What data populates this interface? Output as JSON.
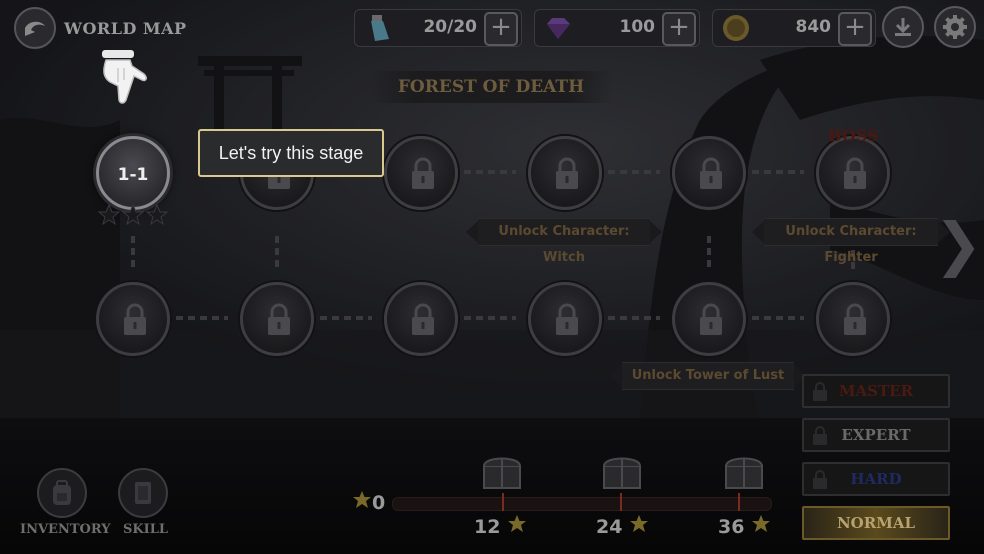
{
  "header": {
    "title": "WORLD MAP",
    "energy": "20/20",
    "gems": "100",
    "gold": "840"
  },
  "stage_group": {
    "title": "FOREST OF DEATH",
    "boss_label": "BOSS"
  },
  "stages": [
    {
      "label": "1-1",
      "locked": false,
      "stars": 0
    },
    {
      "label": "",
      "locked": true
    },
    {
      "label": "",
      "locked": true
    },
    {
      "label": "",
      "locked": true
    },
    {
      "label": "",
      "locked": true
    },
    {
      "label": "",
      "locked": true
    },
    {
      "label": "",
      "locked": true
    },
    {
      "label": "",
      "locked": true
    },
    {
      "label": "",
      "locked": true
    },
    {
      "label": "",
      "locked": true
    },
    {
      "label": "",
      "locked": true
    },
    {
      "label": "",
      "locked": true
    }
  ],
  "unlocks": {
    "witch": "Unlock Character: Witch",
    "fighter": "Unlock Character: Fighter",
    "tower": "Unlock Tower of Lust"
  },
  "tooltip": "Let's try this stage",
  "difficulty": {
    "options": [
      "MASTER",
      "EXPERT",
      "HARD",
      "NORMAL"
    ],
    "selected": "NORMAL",
    "colors": {
      "master": "#4a1a12",
      "expert": "#6a6a6a",
      "hard": "#1e2a60",
      "normal": "#b8a270"
    }
  },
  "bottom_nav": {
    "inventory": "INVENTORY",
    "skill": "SKILL"
  },
  "star_progress": {
    "current": "0",
    "milestones": [
      "12",
      "24",
      "36"
    ],
    "value": 0,
    "max": 36
  }
}
